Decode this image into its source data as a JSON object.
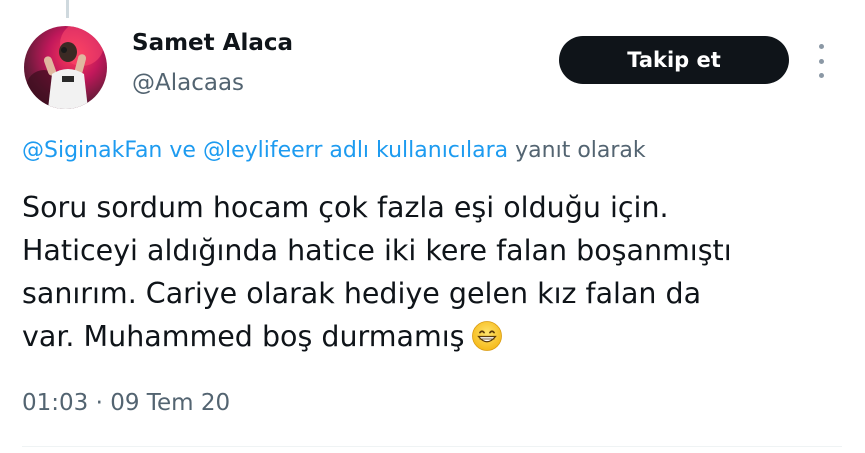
{
  "user": {
    "name": "Samet Alaca",
    "handle": "@Alacaas"
  },
  "follow_button": {
    "label": "Takip et"
  },
  "reply": {
    "mention_1": "@SiginakFan",
    "connector": "ve",
    "mention_2": "@leylifeerr",
    "suffix_link": "adlı kullanıcılara",
    "suffix": "yanıt olarak"
  },
  "tweet": {
    "lines": [
      "Soru sordum hocam çok fazla eşi olduğu için.",
      "Haticeyi aldığında hatice iki kere falan boşanmıştı",
      "sanırım. Cariye olarak hediye gelen kız falan da",
      "var. Muhammed boş durmamış"
    ],
    "emoji": "grinning-face-emoji"
  },
  "timestamp": {
    "time": "01:03",
    "separator": "·",
    "date": "09 Tem 20"
  },
  "colors": {
    "accent": "#1d9bf0",
    "text": "#0f1419",
    "muted": "#536471",
    "button_bg": "#0f1419"
  }
}
